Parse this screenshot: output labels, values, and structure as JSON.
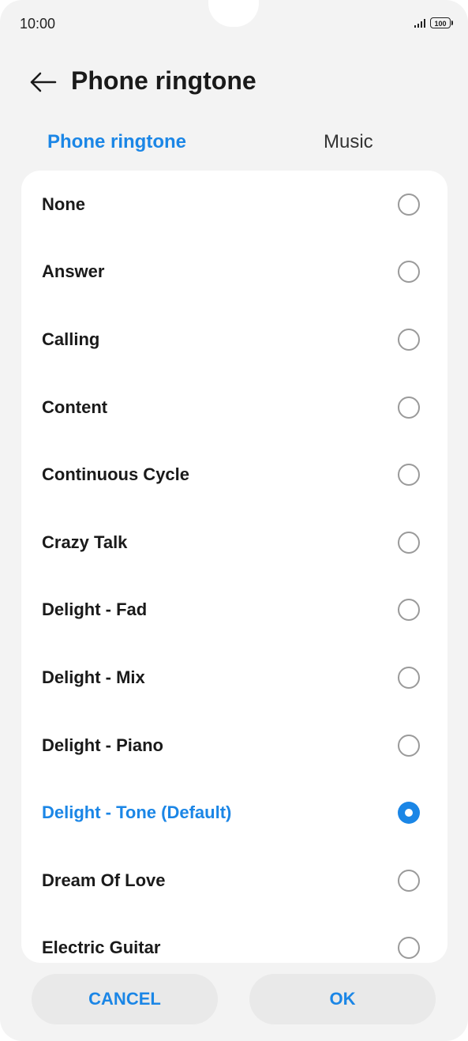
{
  "status_bar": {
    "time": "10:00",
    "battery": "100"
  },
  "header": {
    "title": "Phone ringtone"
  },
  "tabs": [
    {
      "label": "Phone ringtone",
      "active": true
    },
    {
      "label": "Music",
      "active": false
    }
  ],
  "ringtones": [
    {
      "label": "None",
      "selected": false
    },
    {
      "label": "Answer",
      "selected": false
    },
    {
      "label": "Calling",
      "selected": false
    },
    {
      "label": "Content",
      "selected": false
    },
    {
      "label": "Continuous Cycle",
      "selected": false
    },
    {
      "label": "Crazy Talk",
      "selected": false
    },
    {
      "label": "Delight - Fad",
      "selected": false
    },
    {
      "label": "Delight - Mix",
      "selected": false
    },
    {
      "label": "Delight - Piano",
      "selected": false
    },
    {
      "label": "Delight - Tone (Default)",
      "selected": true
    },
    {
      "label": "Dream Of Love",
      "selected": false
    },
    {
      "label": "Electric Guitar",
      "selected": false
    }
  ],
  "footer": {
    "cancel_label": "CANCEL",
    "ok_label": "OK"
  },
  "colors": {
    "accent": "#1b86e6",
    "background": "#f3f3f3",
    "card": "#ffffff"
  },
  "icons": {
    "back": "arrow-left-icon",
    "signal": "signal-icon",
    "battery": "battery-icon"
  }
}
